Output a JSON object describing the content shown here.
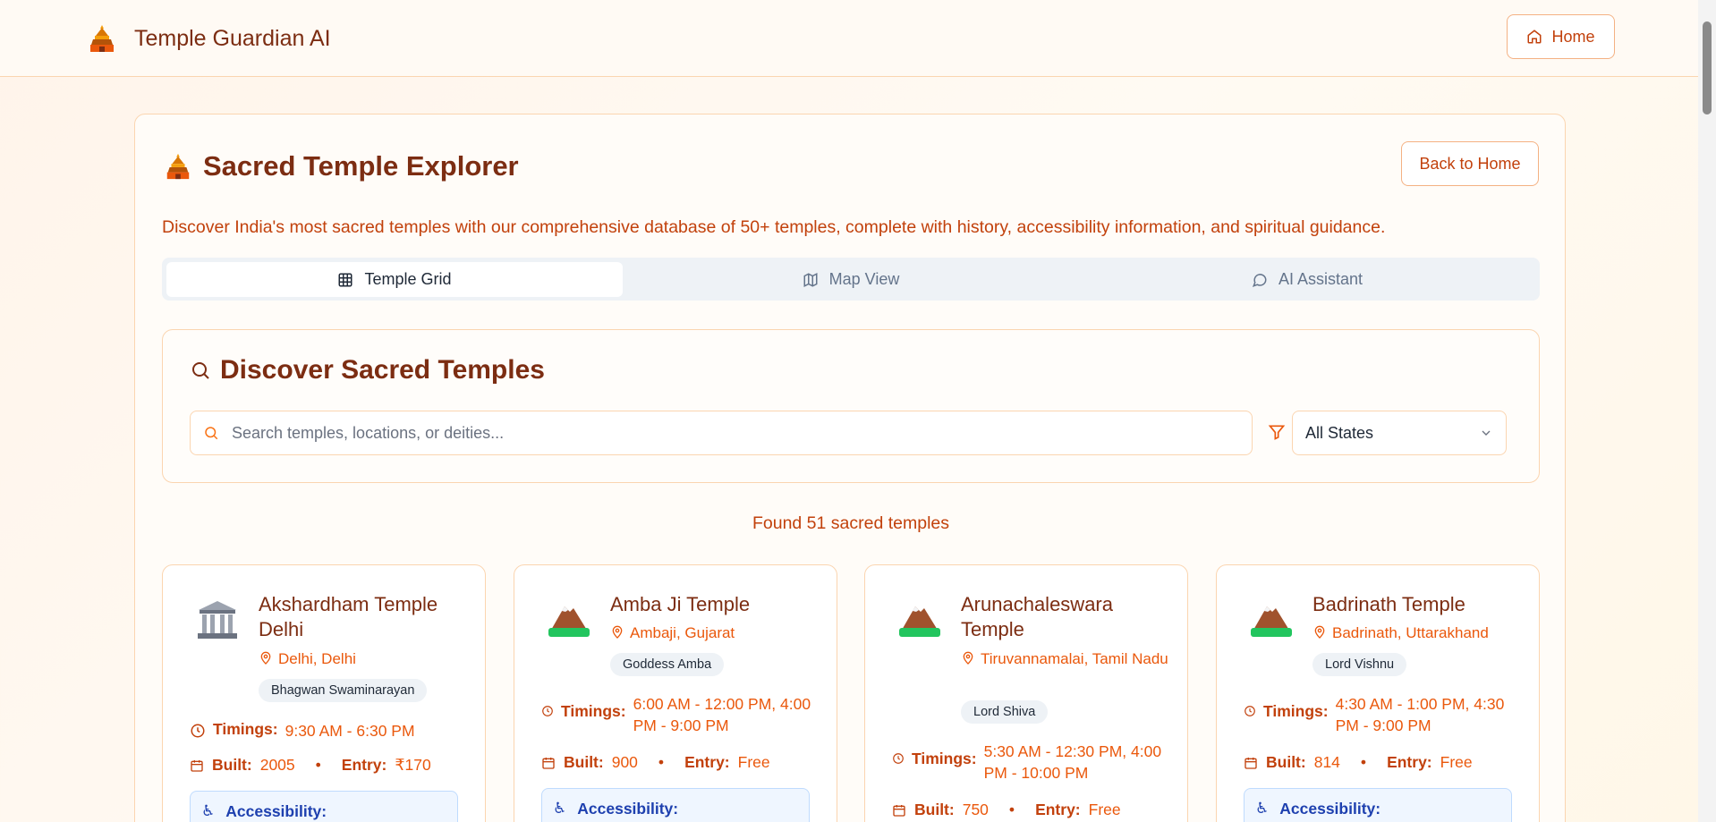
{
  "header": {
    "title": "Temple Guardian AI",
    "home_label": "Home"
  },
  "panel": {
    "title": "Sacred Temple Explorer",
    "back_label": "Back to Home",
    "description": "Discover India's most sacred temples with our comprehensive database of 50+ temples, complete with history, accessibility information, and spiritual guidance."
  },
  "tabs": [
    {
      "label": "Temple Grid",
      "icon": "grid-icon",
      "active": true
    },
    {
      "label": "Map View",
      "icon": "map-icon",
      "active": false
    },
    {
      "label": "AI Assistant",
      "icon": "chat-icon",
      "active": false
    }
  ],
  "search": {
    "title": "Discover Sacred Temples",
    "placeholder": "Search temples, locations, or deities...",
    "value": "",
    "state_filter": "All States"
  },
  "results": {
    "found_text": "Found 51 sacred temples"
  },
  "labels": {
    "timings": "Timings:",
    "built": "Built:",
    "entry": "Entry:",
    "accessibility": "Accessibility:"
  },
  "temples": [
    {
      "name": "Akshardham Temple Delhi",
      "location": "Delhi, Delhi",
      "deity": "Bhagwan Swaminarayan",
      "timings": "9:30 AM - 6:30 PM",
      "built": "2005",
      "entry": "₹170",
      "icon": "classical-building-icon"
    },
    {
      "name": "Amba Ji Temple",
      "location": "Ambaji, Gujarat",
      "deity": "Goddess Amba",
      "timings": "6:00 AM - 12:00 PM, 4:00 PM - 9:00 PM",
      "built": "900",
      "entry": "Free",
      "icon": "mountain-icon"
    },
    {
      "name": "Arunachaleswara Temple",
      "location": "Tiruvannamalai, Tamil Nadu",
      "deity": "Lord Shiva",
      "timings": "5:30 AM - 12:30 PM, 4:00 PM - 10:00 PM",
      "built": "750",
      "entry": "Free",
      "icon": "mountain-icon"
    },
    {
      "name": "Badrinath Temple",
      "location": "Badrinath, Uttarakhand",
      "deity": "Lord Vishnu",
      "timings": "4:30 AM - 1:00 PM, 4:30 PM - 9:00 PM",
      "built": "814",
      "entry": "Free",
      "icon": "mountain-icon"
    }
  ],
  "colors": {
    "brand": "#7c2d12",
    "accent": "#ea580c",
    "border": "#fbd5b0"
  }
}
